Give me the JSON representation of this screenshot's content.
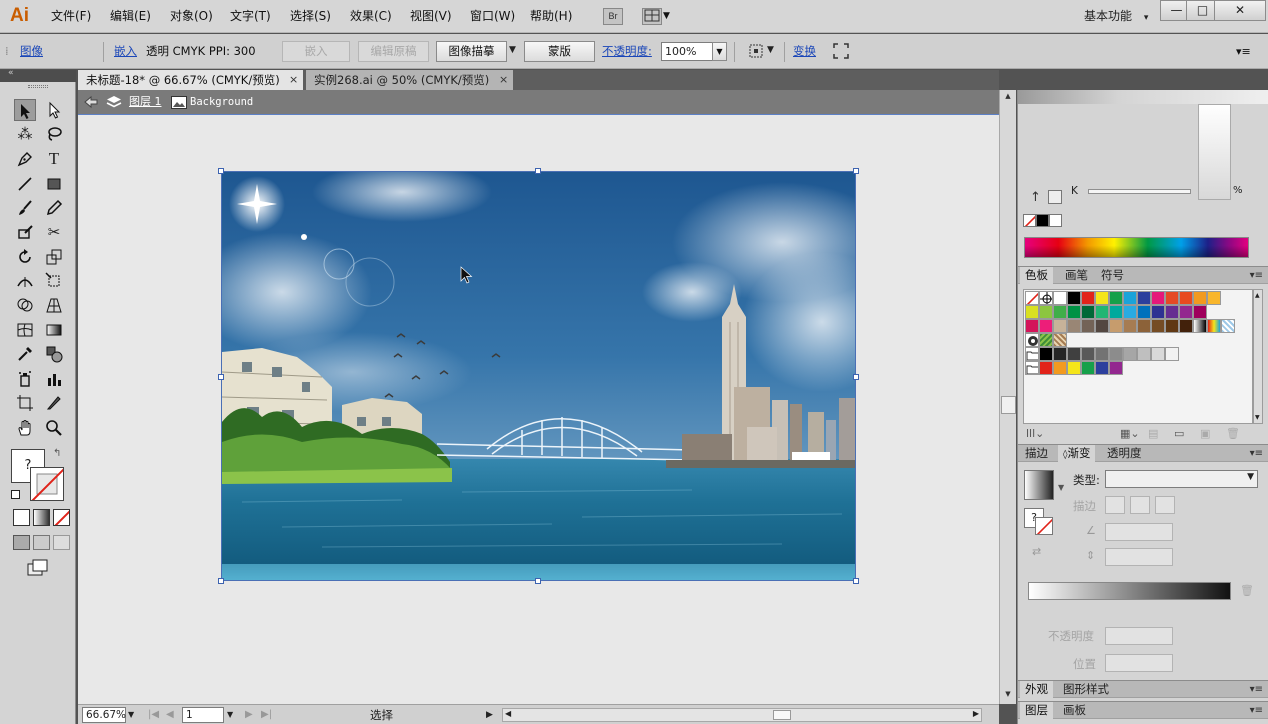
{
  "app": {
    "logo": "Ai",
    "brand_color": "#c95d00"
  },
  "menu": {
    "items": [
      "文件(F)",
      "编辑(E)",
      "对象(O)",
      "文字(T)",
      "选择(S)",
      "效果(C)",
      "视图(V)",
      "窗口(W)",
      "帮助(H)"
    ],
    "bridge_label": "Br",
    "workspace": "基本功能",
    "workspace_arrow": "▾",
    "window_buttons": [
      "—",
      "□",
      "✕"
    ]
  },
  "control": {
    "selection_label": "图像",
    "embed_label": "嵌入",
    "info": "透明  CMYK  PPI: 300",
    "embed_btn": "嵌入",
    "edit_original_btn": "编辑原稿",
    "image_trace_btn": "图像描摹",
    "mask_btn": "蒙版",
    "opacity_label": "不透明度:",
    "opacity_value": "100%",
    "transform_label": "变换"
  },
  "tabs": [
    {
      "label": "未标题-18* @ 66.67% (CMYK/预览)",
      "close": "×"
    },
    {
      "label": "实例268.ai @ 50% (CMYK/预览)",
      "close": "×"
    }
  ],
  "breadcrumb": {
    "layer": "图层 1",
    "object": "Background"
  },
  "status": {
    "zoom": "66.67%",
    "page": "1",
    "tool_label": "选择"
  },
  "panels": {
    "color": {
      "k_label": "K",
      "percent": "%"
    },
    "swatch_tabs": [
      "色板",
      "画笔",
      "符号"
    ],
    "swatches": {
      "row1": [
        "#ffffff",
        "#000000",
        "#e2231a",
        "#f5e51a",
        "#16a04a",
        "#1ba3d9",
        "#2c3f9d",
        "#e5187a",
        "#e54a25",
        "#e84a1e",
        "#f29a1f",
        "#f8b62c"
      ],
      "row2": [
        "#d9e021",
        "#8cc63f",
        "#3fae49",
        "#009245",
        "#006837",
        "#22b573",
        "#00a99d",
        "#29abe2",
        "#0071bc",
        "#2e3192",
        "#662d91",
        "#93278f",
        "#9e005d"
      ],
      "row3": [
        "#d4145a",
        "#ed1e79",
        "#c7b299",
        "#998675",
        "#736357",
        "#534741",
        "#c69c6d",
        "#a67c52",
        "#8c6239",
        "#754c24",
        "#603813",
        "#42210b"
      ],
      "grays": [
        "#000000",
        "#262626",
        "#404040",
        "#595959",
        "#737373",
        "#8c8c8c",
        "#a6a6a6",
        "#bfbfbf",
        "#d9d9d9",
        "#f2f2f2"
      ],
      "group": [
        "#e2231a",
        "#f29a1f",
        "#f5e51a",
        "#16a04a",
        "#2c3f9d",
        "#93278f"
      ]
    },
    "gradient_tabs": [
      "描边",
      "渐变",
      "透明度"
    ],
    "gradient": {
      "type_label": "类型:",
      "stroke_label": "描边",
      "opacity_label": "不透明度",
      "location_label": "位置"
    },
    "bottom_tabs1": [
      "外观",
      "图形样式"
    ],
    "bottom_tabs2": [
      "图层",
      "画板"
    ]
  }
}
